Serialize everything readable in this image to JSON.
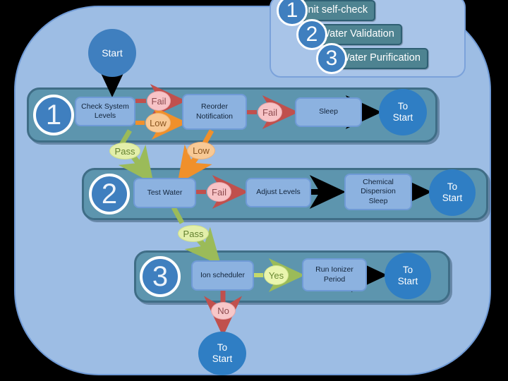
{
  "diagram": {
    "title_legend": [
      {
        "num": "1",
        "label": "Unit self-check"
      },
      {
        "num": "2",
        "label": "Water Validation"
      },
      {
        "num": "3",
        "label": "Water Purification"
      }
    ],
    "start": {
      "label": "Start"
    },
    "rows": [
      {
        "num": "1",
        "boxes": [
          {
            "name": "check-system-levels",
            "line1": "Check System",
            "line2": "Levels"
          },
          {
            "name": "reorder-notification",
            "line1": "Reorder",
            "line2": "Notification"
          },
          {
            "name": "sleep",
            "line1": "Sleep",
            "line2": ""
          }
        ],
        "terminator": {
          "line1": "To",
          "line2": "Start"
        }
      },
      {
        "num": "2",
        "boxes": [
          {
            "name": "test-water",
            "line1": "Test Water",
            "line2": ""
          },
          {
            "name": "adjust-levels",
            "line1": "Adjust Levels",
            "line2": ""
          },
          {
            "name": "chemical-dispersion-sleep",
            "line1": "Chemical",
            "line2": "Dispersion",
            "line3": "Sleep"
          }
        ],
        "terminator": {
          "line1": "To",
          "line2": "Start"
        }
      },
      {
        "num": "3",
        "boxes": [
          {
            "name": "ion-scheduler",
            "line1": "Ion scheduler",
            "line2": ""
          },
          {
            "name": "run-ionizer-period",
            "line1": "Run Ionizer",
            "line2": "Period"
          }
        ],
        "terminator": {
          "line1": "To",
          "line2": "Start"
        }
      }
    ],
    "labels": {
      "fail_1": "Fail",
      "low_1": "Low",
      "fail_2": "Fail",
      "pass_1": "Pass",
      "low_2": "Low",
      "fail_3": "Fail",
      "pass_2": "Pass",
      "yes_1": "Yes",
      "no_1": "No"
    },
    "final_terminator": {
      "line1": "To",
      "line2": "Start"
    },
    "colors": {
      "panel_bg": "#9dbde4",
      "band_bg": "#5d95ae",
      "box_bg": "#8cb2e0",
      "circle_blue": "#3f7fbf",
      "fail_pink": "#f7c3c6",
      "low_orange": "#f8c995",
      "pass_green": "#e3efaa",
      "legend_box": "#4e8391",
      "arrow_black": "#000000",
      "arrow_red": "#c0504d",
      "arrow_orange": "#f0902b",
      "arrow_green": "#9bbb59"
    }
  }
}
